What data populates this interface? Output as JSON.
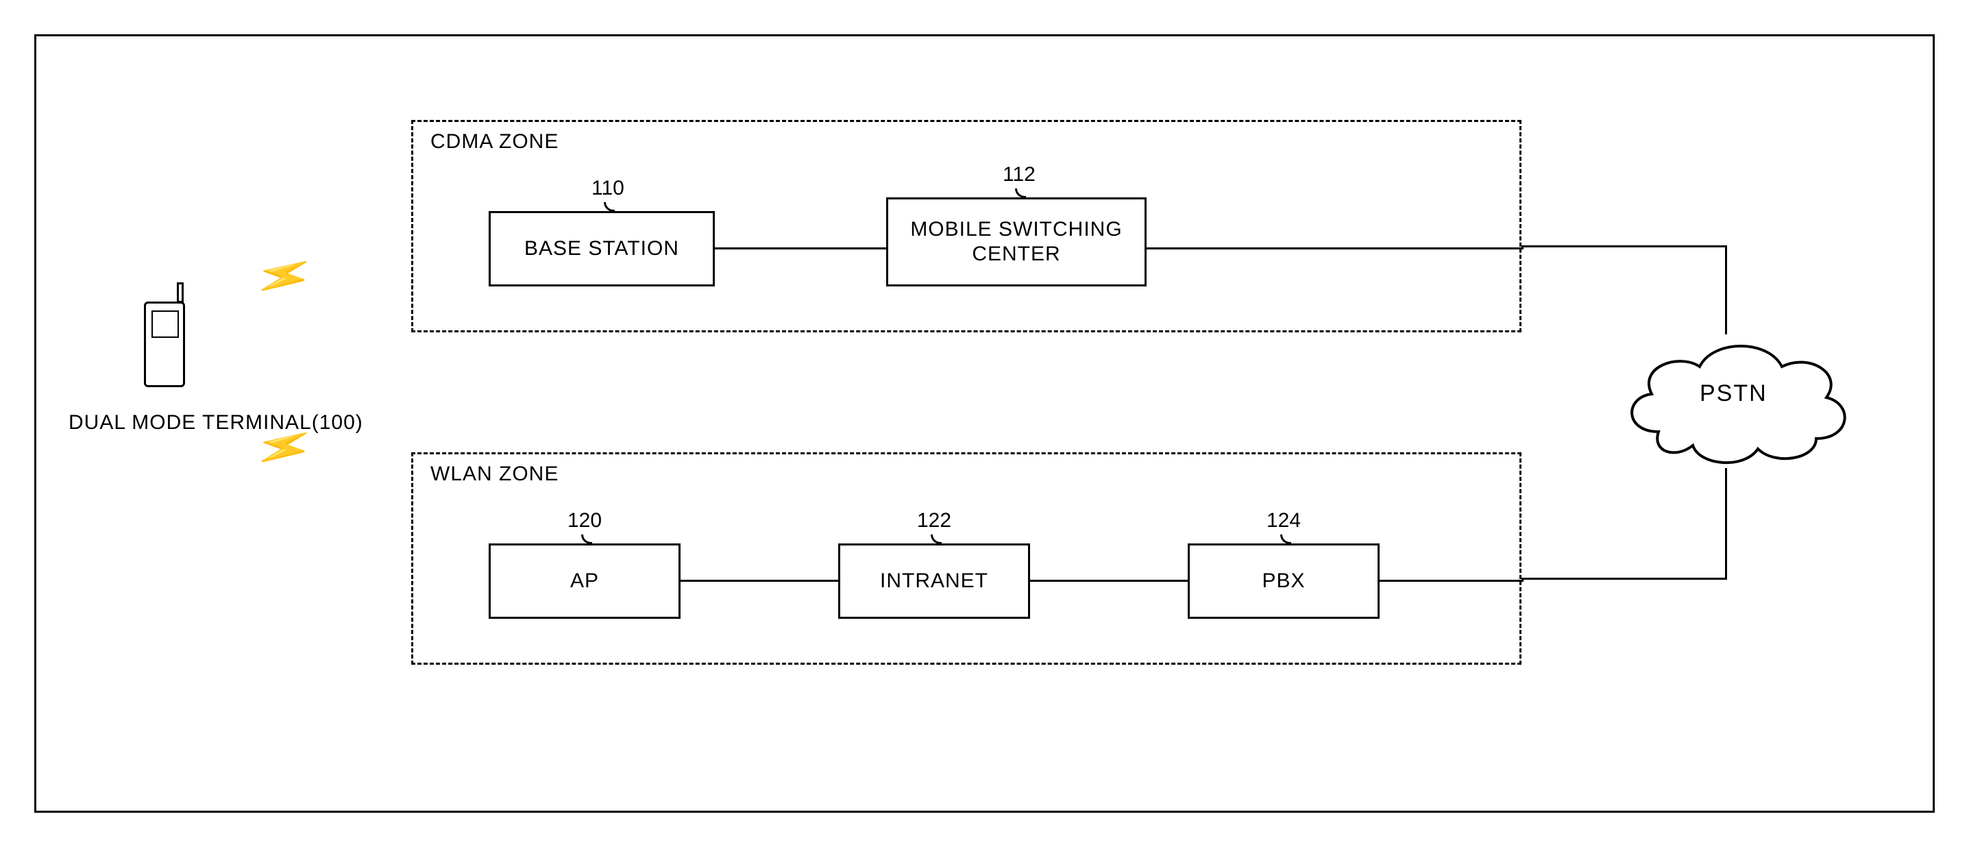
{
  "terminal": {
    "label": "DUAL MODE TERMINAL(100)"
  },
  "zones": {
    "cdma": {
      "title": "CDMA ZONE",
      "base_station": {
        "label": "BASE STATION",
        "ref": "110"
      },
      "msc": {
        "label": "MOBILE SWITCHING\nCENTER",
        "ref": "112"
      }
    },
    "wlan": {
      "title": "WLAN ZONE",
      "ap": {
        "label": "AP",
        "ref": "120"
      },
      "intranet": {
        "label": "INTRANET",
        "ref": "122"
      },
      "pbx": {
        "label": "PBX",
        "ref": "124"
      }
    }
  },
  "pstn": {
    "label": "PSTN"
  }
}
